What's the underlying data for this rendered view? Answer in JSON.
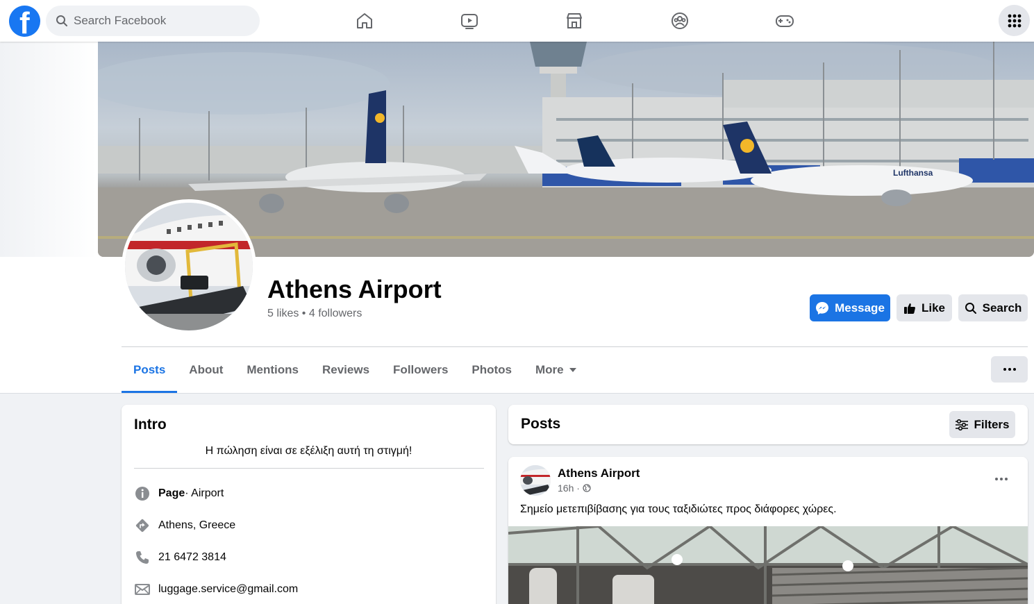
{
  "topbar": {
    "search_placeholder": "Search Facebook",
    "logo_letter": "f",
    "nav_icons": [
      "home-icon",
      "watch-icon",
      "marketplace-icon",
      "groups-icon",
      "gaming-icon"
    ],
    "menu_icon": "grid-menu-icon"
  },
  "profile": {
    "name": "Athens Airport",
    "likes": "5 likes",
    "separator": " • ",
    "followers": "4 followers"
  },
  "actions": {
    "message": "Message",
    "like": "Like",
    "search": "Search"
  },
  "tabs": [
    {
      "label": "Posts",
      "active": true
    },
    {
      "label": "About"
    },
    {
      "label": "Mentions"
    },
    {
      "label": "Reviews"
    },
    {
      "label": "Followers"
    },
    {
      "label": "Photos"
    },
    {
      "label": "More"
    }
  ],
  "intro": {
    "title": "Intro",
    "bio": "Η πώληση είναι σε εξέλιξη αυτή τη στιγμή!",
    "page_label": "Page",
    "page_category": " · Airport",
    "location": "Athens, Greece",
    "phone": "21 6472 3814",
    "email": "luggage.service@gmail.com"
  },
  "posts_section": {
    "title": "Posts",
    "filters": "Filters"
  },
  "post": {
    "author": "Athens Airport",
    "time": "16h ·",
    "text": "Σημείο μετεπιβίβασης για τους ταξιδιώτες προς διάφορες χώρες."
  },
  "colors": {
    "brand": "#1877f2",
    "primary_button": "#1b74e4",
    "secondary_button": "#e4e6eb",
    "muted_text": "#65676b"
  }
}
